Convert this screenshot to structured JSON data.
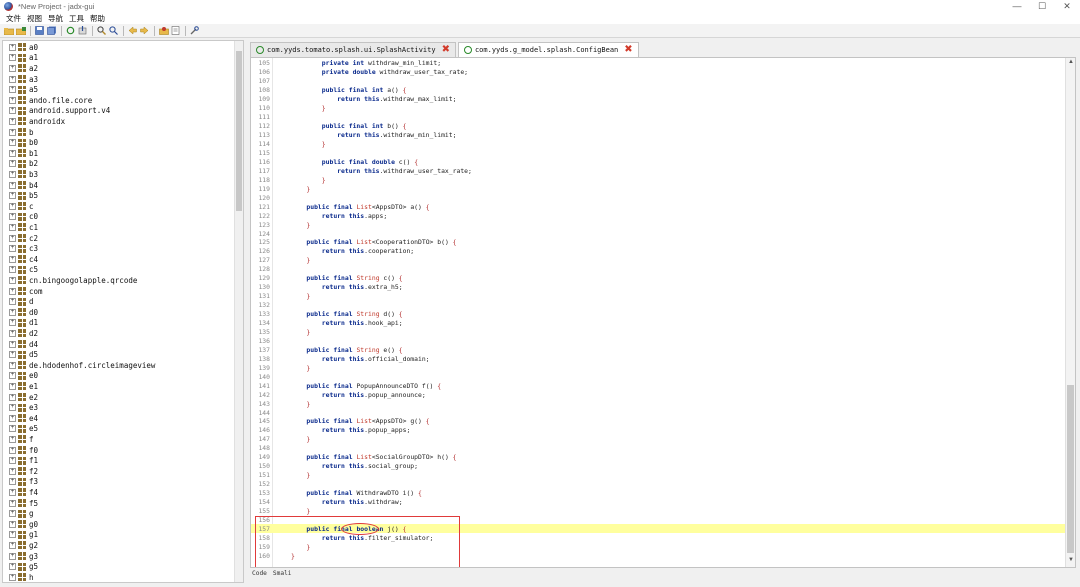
{
  "window": {
    "title": "*New Project - jadx-gui",
    "min_glyph": "—",
    "max_glyph": "☐",
    "close_glyph": "✕"
  },
  "menu": [
    "文件",
    "视图",
    "导航",
    "工具",
    "帮助"
  ],
  "toolbar": {
    "icons": [
      "open-folder-icon",
      "add-files-icon",
      "save-icon",
      "save-all-icon",
      "sync-icon",
      "export-icon",
      "search-icon",
      "find-class-icon",
      "back-icon",
      "forward-icon",
      "deobfuscate-icon",
      "logs-icon",
      "settings-icon"
    ]
  },
  "tree": {
    "items": [
      "a0",
      "a1",
      "a2",
      "a3",
      "a5",
      "ando.file.core",
      "android.support.v4",
      "androidx",
      "b",
      "b0",
      "b1",
      "b2",
      "b3",
      "b4",
      "b5",
      "c",
      "c0",
      "c1",
      "c2",
      "c3",
      "c4",
      "c5",
      "cn.bingoogolapple.qrcode",
      "com",
      "d",
      "d0",
      "d1",
      "d2",
      "d4",
      "d5",
      "de.hdodenhof.circleimageview",
      "e0",
      "e1",
      "e2",
      "e3",
      "e4",
      "e5",
      "f",
      "f0",
      "f1",
      "f2",
      "f3",
      "f4",
      "f5",
      "g",
      "g0",
      "g1",
      "g2",
      "g3",
      "g5",
      "h"
    ]
  },
  "tabs": [
    {
      "label": "com.yyds.tomato.splash.ui.SplashActivity",
      "active": false
    },
    {
      "label": "com.yyds.g_model.splash.ConfigBean",
      "active": true
    }
  ],
  "code": {
    "lines": [
      {
        "n": "105",
        "t": "        private int withdraw_min_limit;"
      },
      {
        "n": "106",
        "t": "        private double withdraw_user_tax_rate;"
      },
      {
        "n": "107",
        "t": ""
      },
      {
        "n": "108",
        "t": "        public final int a() {"
      },
      {
        "n": "109",
        "t": "            return this.withdraw_max_limit;"
      },
      {
        "n": "110",
        "t": "        }"
      },
      {
        "n": "111",
        "t": ""
      },
      {
        "n": "112",
        "t": "        public final int b() {"
      },
      {
        "n": "113",
        "t": "            return this.withdraw_min_limit;"
      },
      {
        "n": "114",
        "t": "        }"
      },
      {
        "n": "115",
        "t": ""
      },
      {
        "n": "116",
        "t": "        public final double c() {"
      },
      {
        "n": "117",
        "t": "            return this.withdraw_user_tax_rate;"
      },
      {
        "n": "118",
        "t": "        }"
      },
      {
        "n": "119",
        "t": "    }"
      },
      {
        "n": "120",
        "t": ""
      },
      {
        "n": "121",
        "t": "    public final List<AppsDTO> a() {"
      },
      {
        "n": "122",
        "t": "        return this.apps;"
      },
      {
        "n": "123",
        "t": "    }"
      },
      {
        "n": "124",
        "t": ""
      },
      {
        "n": "125",
        "t": "    public final List<CooperationDTO> b() {"
      },
      {
        "n": "126",
        "t": "        return this.cooperation;"
      },
      {
        "n": "127",
        "t": "    }"
      },
      {
        "n": "128",
        "t": ""
      },
      {
        "n": "129",
        "t": "    public final String c() {"
      },
      {
        "n": "130",
        "t": "        return this.extra_h5;"
      },
      {
        "n": "131",
        "t": "    }"
      },
      {
        "n": "132",
        "t": ""
      },
      {
        "n": "133",
        "t": "    public final String d() {"
      },
      {
        "n": "134",
        "t": "        return this.hook_api;"
      },
      {
        "n": "135",
        "t": "    }"
      },
      {
        "n": "136",
        "t": ""
      },
      {
        "n": "137",
        "t": "    public final String e() {"
      },
      {
        "n": "138",
        "t": "        return this.official_domain;"
      },
      {
        "n": "139",
        "t": "    }"
      },
      {
        "n": "140",
        "t": ""
      },
      {
        "n": "141",
        "t": "    public final PopupAnnounceDTO f() {"
      },
      {
        "n": "142",
        "t": "        return this.popup_announce;"
      },
      {
        "n": "143",
        "t": "    }"
      },
      {
        "n": "144",
        "t": ""
      },
      {
        "n": "145",
        "t": "    public final List<AppsDTO> g() {"
      },
      {
        "n": "146",
        "t": "        return this.popup_apps;"
      },
      {
        "n": "147",
        "t": "    }"
      },
      {
        "n": "148",
        "t": ""
      },
      {
        "n": "149",
        "t": "    public final List<SocialGroupDTO> h() {"
      },
      {
        "n": "150",
        "t": "        return this.social_group;"
      },
      {
        "n": "151",
        "t": "    }"
      },
      {
        "n": "152",
        "t": ""
      },
      {
        "n": "153",
        "t": "    public final WithdrawDTO i() {"
      },
      {
        "n": "154",
        "t": "        return this.withdraw;"
      },
      {
        "n": "155",
        "t": "    }"
      },
      {
        "n": "156",
        "t": ""
      },
      {
        "n": "157",
        "t": "    public final boolean j() {",
        "highlight": true
      },
      {
        "n": "158",
        "t": "        return this.filter_simulator;"
      },
      {
        "n": "159",
        "t": "    }"
      },
      {
        "n": "160",
        "t": "}"
      }
    ]
  },
  "status": {
    "left": "Code",
    "right": "Smali"
  },
  "colors": {
    "keyword": "#0a2a8c",
    "type": "#c0392b",
    "highlight_line": "#ffff9e",
    "annotation": "#e03a3a"
  }
}
